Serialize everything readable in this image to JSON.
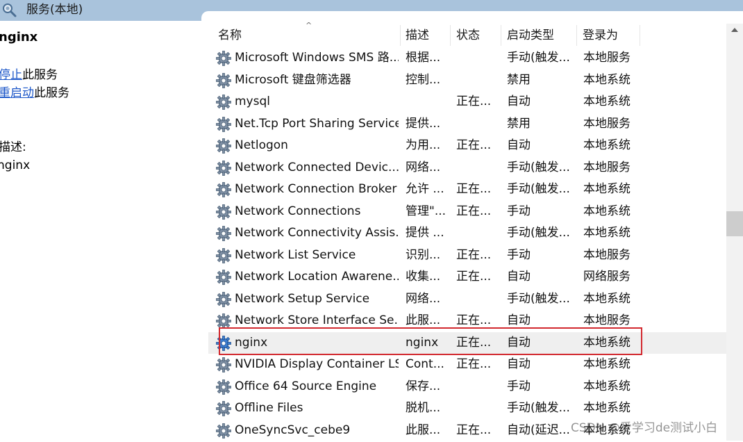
{
  "window": {
    "title": "服务(本地)",
    "icon": "services-magnifier-icon"
  },
  "left_pane": {
    "service_name": "nginx",
    "actions": [
      {
        "link": "停止",
        "suffix": "此服务"
      },
      {
        "link": "重启动",
        "suffix": "此服务"
      }
    ],
    "description_label": "描述:",
    "description_value": "nginx"
  },
  "columns": [
    "名称",
    "描述",
    "状态",
    "启动类型",
    "登录为"
  ],
  "sort_indicator": "^",
  "rows": [
    {
      "name": "Microsoft Windows SMS 路...",
      "desc": "根据...",
      "status": "",
      "startup": "手动(触发...",
      "logon": "本地服务"
    },
    {
      "name": "Microsoft 键盘筛选器",
      "desc": "控制...",
      "status": "",
      "startup": "禁用",
      "logon": "本地系统"
    },
    {
      "name": "mysql",
      "desc": "",
      "status": "正在...",
      "startup": "自动",
      "logon": "本地系统"
    },
    {
      "name": "Net.Tcp Port Sharing Service",
      "desc": "提供...",
      "status": "",
      "startup": "禁用",
      "logon": "本地服务"
    },
    {
      "name": "Netlogon",
      "desc": "为用...",
      "status": "正在...",
      "startup": "自动",
      "logon": "本地系统"
    },
    {
      "name": "Network Connected Devic...",
      "desc": "网络...",
      "status": "",
      "startup": "手动(触发...",
      "logon": "本地服务"
    },
    {
      "name": "Network Connection Broker",
      "desc": "允许 ...",
      "status": "正在...",
      "startup": "手动(触发...",
      "logon": "本地系统"
    },
    {
      "name": "Network Connections",
      "desc": "管理\"...",
      "status": "正在...",
      "startup": "手动",
      "logon": "本地系统"
    },
    {
      "name": "Network Connectivity Assis...",
      "desc": "提供 ...",
      "status": "",
      "startup": "手动(触发...",
      "logon": "本地系统"
    },
    {
      "name": "Network List Service",
      "desc": "识别...",
      "status": "正在...",
      "startup": "手动",
      "logon": "本地服务"
    },
    {
      "name": "Network Location Awarene...",
      "desc": "收集...",
      "status": "正在...",
      "startup": "自动",
      "logon": "网络服务"
    },
    {
      "name": "Network Setup Service",
      "desc": "网络...",
      "status": "",
      "startup": "手动(触发...",
      "logon": "本地系统"
    },
    {
      "name": "Network Store Interface Se...",
      "desc": "此服...",
      "status": "正在...",
      "startup": "自动",
      "logon": "本地服务"
    },
    {
      "name": "nginx",
      "desc": "nginx",
      "status": "正在...",
      "startup": "自动",
      "logon": "本地系统"
    },
    {
      "name": "NVIDIA Display Container LS",
      "desc": "Cont...",
      "status": "正在...",
      "startup": "自动",
      "logon": "本地系统"
    },
    {
      "name": "Office 64 Source Engine",
      "desc": "保存...",
      "status": "",
      "startup": "手动",
      "logon": "本地系统"
    },
    {
      "name": "Offline Files",
      "desc": "脱机...",
      "status": "",
      "startup": "手动(触发...",
      "logon": "本地系统"
    },
    {
      "name": "OneSyncSvc_cebe9",
      "desc": "此服...",
      "status": "正在...",
      "startup": "自动(延迟...",
      "logon": "本地系统"
    }
  ],
  "selected_row_index": 13,
  "row_icon": "gear-icon",
  "colors": {
    "title_bar": "#a9c3dc",
    "highlight_box": "#d2282e",
    "link": "#1a55c8",
    "selected_row": "#efefef"
  },
  "watermark": "CSDN @爱学习de测试小白"
}
